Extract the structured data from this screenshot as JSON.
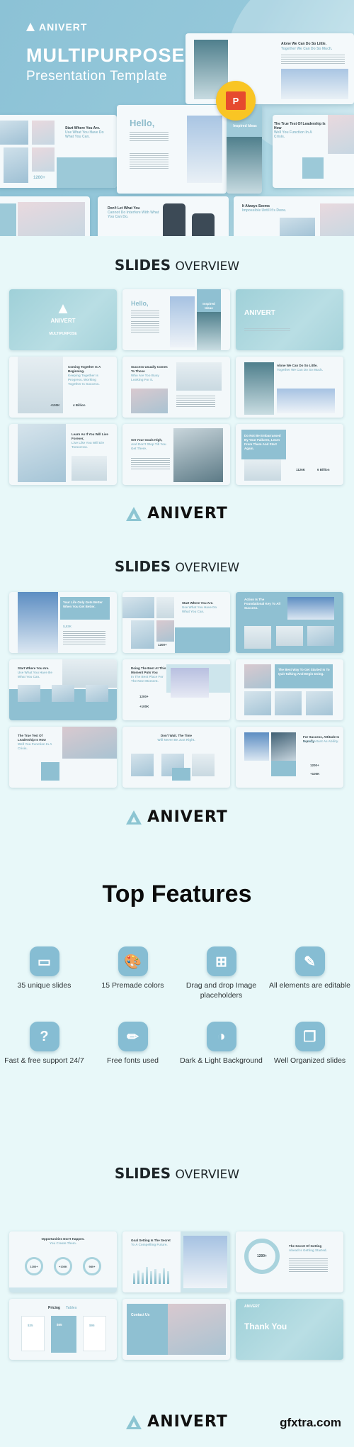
{
  "hero": {
    "brand": "ANIVERT",
    "title": "MULTIPURPOSE",
    "subtitle": "Presentation Template",
    "badge_icon": "powerpoint-icon",
    "badge_letter": "P",
    "mockups": {
      "alone": {
        "title": "Alone We Can Do So Little.",
        "sub": "Together We Can Do So Much."
      },
      "hello": {
        "title": "Hello,"
      },
      "inspired": {
        "title": "Inspired Ideas"
      },
      "start": {
        "title": "Start Where You Are.",
        "sub": "Use What You Have Do What You Can.",
        "stat": "1200+"
      },
      "leadership": {
        "title": "The True Test Of Leadership Is How",
        "sub": "Well You Function In A Crisis."
      },
      "dont_let": {
        "title": "Don't Let What You",
        "sub": "Cannot Do Interfere With What You Can Do."
      },
      "always": {
        "title": "It Always Seems",
        "sub": "Impossible Until It's Done."
      }
    }
  },
  "sections": [
    {
      "heading_bold": "SLIDES",
      "heading_light": "OVERVIEW",
      "slides": [
        {
          "kind": "cover",
          "title": "ANIVERT",
          "sub": "MULTIPURPOSE"
        },
        {
          "kind": "hello",
          "title": "Hello,",
          "sub": "Inspired Ideas"
        },
        {
          "kind": "cover2",
          "title": "ANIVERT"
        },
        {
          "kind": "text",
          "title": "Coming Together Is A Beginning.",
          "sub": "Keeping Together Is Progress. Working Together Is Success.",
          "stat1": "+100K",
          "stat2": "4 Billion"
        },
        {
          "kind": "text",
          "title": "Success Usually Comes To Those",
          "sub": "Who Are Too Busy Looking For It."
        },
        {
          "kind": "text",
          "title": "Alone We Can Do So Little.",
          "sub": "Together We Can Do So Much."
        },
        {
          "kind": "text",
          "title": "Learn As If You Will Live Forever,",
          "sub": "Live Like You Will Die Tomorrow."
        },
        {
          "kind": "text",
          "title": "Set Your Goals High,",
          "sub": "And Don't Stop Till You Get There."
        },
        {
          "kind": "panel",
          "title": "Do Not Be Embarrassed By Your Failures, Learn From Them And Start Again.",
          "stat1": "1126K",
          "stat2": "6 Billion"
        }
      ]
    },
    {
      "heading_bold": "SLIDES",
      "heading_light": "OVERVIEW",
      "slides": [
        {
          "kind": "panel",
          "title": "Your Life Only Gets Better When You Get Better.",
          "stat1": "$,52K"
        },
        {
          "kind": "text",
          "title": "Start Where You Are.",
          "sub": "Use What You Have Do What You Can.",
          "stat1": "1200+"
        },
        {
          "kind": "panel",
          "title": "Action Is The Foundational Key To All Success."
        },
        {
          "kind": "text",
          "title": "Start Where You Are.",
          "sub": "Use What You Have Be What You Can."
        },
        {
          "kind": "text",
          "title": "Doing The Best At This Moment Puts You",
          "sub": "In The Best Place For The Next Moment.",
          "stat1": "1200+",
          "stat2": "+100K"
        },
        {
          "kind": "panel",
          "title": "The Best Way To Get Started Is To Quit Talking And Begin Doing."
        },
        {
          "kind": "text",
          "title": "The True Test Of Leadership Is How",
          "sub": "Well You Function In A Crisis."
        },
        {
          "kind": "text",
          "title": "Don't Wait. The Time",
          "sub": "Will Never Be Just Right."
        },
        {
          "kind": "text",
          "title": "For Success, Attitude Is Equally",
          "sub": "As Important As Ability.",
          "stat1": "1200+",
          "stat2": "+100K"
        }
      ]
    },
    {
      "heading_bold": "SLIDES",
      "heading_light": "OVERVIEW",
      "slides": [
        {
          "kind": "rings",
          "title": "Opportunities Don't Happen.",
          "sub": "You Create Them.",
          "rings": [
            "1200+",
            "+100K",
            "980+"
          ]
        },
        {
          "kind": "chart",
          "title": "Goal Setting Is The Secret",
          "sub": "To A Compelling Future."
        },
        {
          "kind": "donut",
          "title": "The Secret Of Getting",
          "sub": "Ahead Is Getting Started.",
          "stat1": "1200+"
        },
        {
          "kind": "pricing",
          "title": "Pricing",
          "sub": "Tables",
          "plans": [
            "$35",
            "$65",
            "$95"
          ]
        },
        {
          "kind": "contact",
          "title": "Contact Us"
        },
        {
          "kind": "thanks",
          "title": "Thank You",
          "brand": "ANIVERT"
        }
      ]
    }
  ],
  "brand_footer": "ANIVERT",
  "features": {
    "title": "Top Features",
    "items": [
      {
        "icon": "slides-icon",
        "glyph": "▭",
        "label": "35 unique slides"
      },
      {
        "icon": "palette-icon",
        "glyph": "🎨",
        "label": "15 Premade colors"
      },
      {
        "icon": "image-add-icon",
        "glyph": "⊞",
        "label": "Drag and drop Image placeholders"
      },
      {
        "icon": "pen-tool-icon",
        "glyph": "✎",
        "label": "All elements are editable"
      },
      {
        "icon": "help-icon",
        "glyph": "?",
        "label": "Fast & free support 24/7"
      },
      {
        "icon": "pencil-icon",
        "glyph": "✏",
        "label": "Free fonts used"
      },
      {
        "icon": "contrast-icon",
        "glyph": "◑",
        "label": "Dark & Light Background"
      },
      {
        "icon": "stack-icon",
        "glyph": "❐",
        "label": "Well Organized slides"
      }
    ]
  },
  "watermark": "gfxtra.com"
}
